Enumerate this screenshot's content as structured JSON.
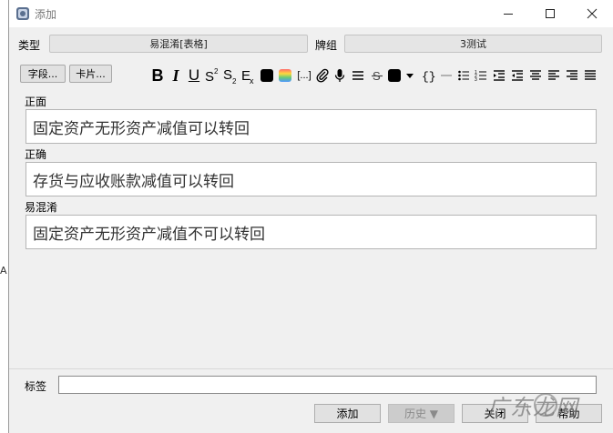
{
  "behind": {
    "text": "A"
  },
  "window": {
    "title": "添加"
  },
  "top": {
    "type_label": "类型",
    "type_value": "易混淆[表格]",
    "deck_label": "牌组",
    "deck_value": "3测试"
  },
  "toolbar": {
    "fields_label": "字段...",
    "cards_label": "卡片...",
    "bold": "B",
    "italic": "I",
    "underline": "U",
    "cloze": "[...]",
    "color_accent": "#000000"
  },
  "fields": [
    {
      "label": "正面",
      "value": "固定资产无形资产减值可以转回"
    },
    {
      "label": "正确",
      "value": "存货与应收账款减值可以转回"
    },
    {
      "label": "易混淆",
      "value": "固定资产无形资产减值不可以转回"
    }
  ],
  "tags": {
    "label": "标签",
    "value": ""
  },
  "buttons": {
    "add": "添加",
    "history": "历史 ▼",
    "close": "关闭",
    "help": "帮助"
  },
  "watermark": {
    "text": "广东龙网"
  }
}
